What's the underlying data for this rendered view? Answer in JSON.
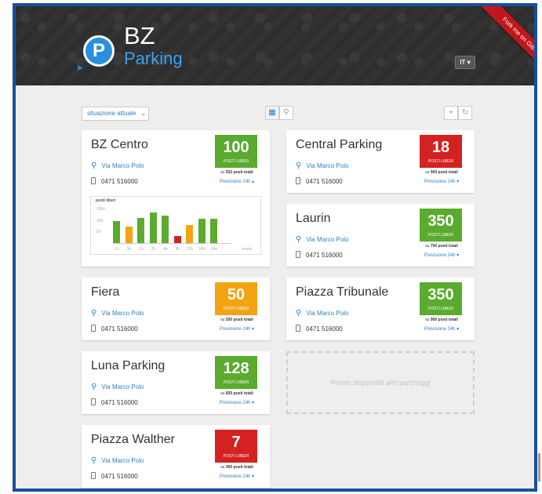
{
  "header": {
    "logo_letter": "P",
    "logo_line1": "BZ",
    "logo_line2": "Parking",
    "lang": "IT ▾",
    "ribbon": "Fork me on Github"
  },
  "toolbar": {
    "select_label": "situazione attuale",
    "select_icon": "chevron-down",
    "view_grid_icon": "grid",
    "view_map_icon": "map-pin",
    "locate_icon": "crosshair",
    "refresh_icon": "refresh"
  },
  "parkings": [
    {
      "name": "BZ Centro",
      "free": "100",
      "free_label": "POSTI LIBERI",
      "status": "green",
      "address": "Via Marco Polo",
      "phone": "0471 516000",
      "total_prefix": "su",
      "total_value": "932 posti totali",
      "forecast": "Previsione 24h ▴"
    },
    {
      "name": "Central Parking",
      "free": "18",
      "free_label": "POSTI LIBERI",
      "status": "red",
      "address": "Via Marco Polo",
      "phone": "0471 516000",
      "total_prefix": "su",
      "total_value": "900 posti totali",
      "forecast": "Previsione 24h ▾"
    },
    {
      "name": "Laurin",
      "free": "350",
      "free_label": "POSTI LIBERI",
      "status": "green",
      "address": "Via Marco Polo",
      "phone": "0471 516000",
      "total_prefix": "su",
      "total_value": "700 posti totali",
      "forecast": "Previsione 24h ▾"
    },
    {
      "name": "Fiera",
      "free": "50",
      "free_label": "POSTI LIBERI",
      "status": "orange",
      "address": "Via Marco Polo",
      "phone": "0471 516000",
      "total_prefix": "su",
      "total_value": "550 posti totali",
      "forecast": "Previsione 24h ▾"
    },
    {
      "name": "Piazza Tribunale",
      "free": "350",
      "free_label": "POSTI LIBERI",
      "status": "green",
      "address": "Via Marco Polo",
      "phone": "0471 516000",
      "total_prefix": "su",
      "total_value": "900 posti totali",
      "forecast": "Previsione 24h ▾"
    },
    {
      "name": "Luna Parking",
      "free": "128",
      "free_label": "POSTI LIBERI",
      "status": "green",
      "address": "Via Marco Polo",
      "phone": "0471 516000",
      "total_prefix": "su",
      "total_value": "820 posti totali",
      "forecast": "Previsione 24h ▾"
    },
    {
      "name": "Piazza Walther",
      "free": "7",
      "free_label": "POSTI LIBERI",
      "status": "red",
      "address": "Via Marco Polo",
      "phone": "0471 516000",
      "total_prefix": "su",
      "total_value": "450 posti totali",
      "forecast": "Previsione 24h ▾"
    }
  ],
  "placeholder": "Presto disponibili altri parcheggi",
  "colors": {
    "green": "#5aab2e",
    "red": "#d42121",
    "orange": "#f2a312",
    "accent": "#2f7fc4"
  },
  "chart_data": {
    "type": "bar",
    "title": "posti liberi",
    "xlabel": "orario",
    "ylabel": "",
    "categories": [
      "1h",
      "3h",
      "1h",
      "2h",
      "4h",
      "8h",
      "12h",
      "18h",
      "24h"
    ],
    "values": [
      95,
      72,
      110,
      132,
      120,
      32,
      80,
      105,
      105
    ],
    "bar_colors": [
      "green",
      "orange",
      "green",
      "green",
      "green",
      "red",
      "orange",
      "green",
      "green"
    ],
    "yticks": [
      "150+",
      "100",
      "50"
    ],
    "ylim": [
      0,
      150
    ]
  }
}
